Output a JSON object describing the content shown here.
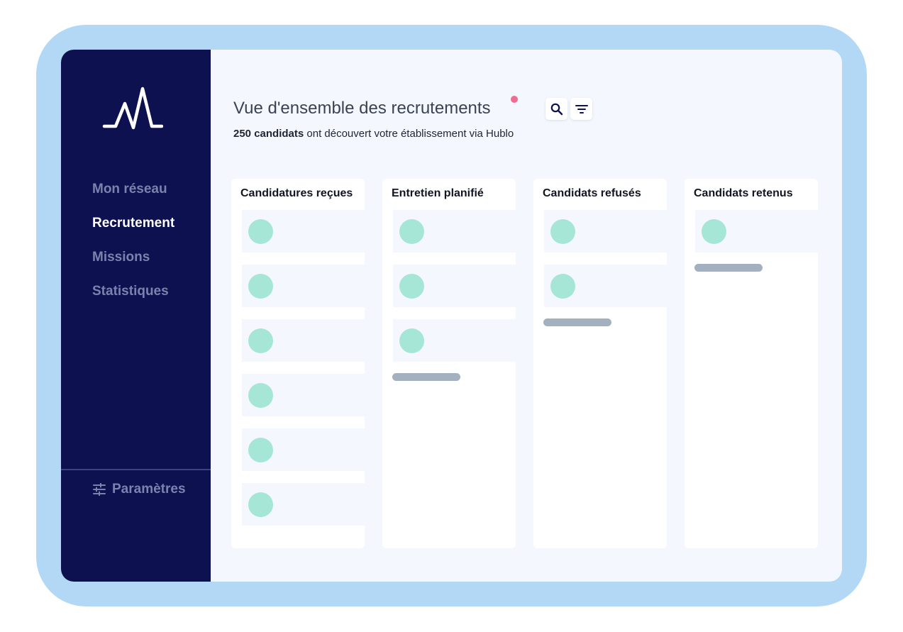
{
  "sidebar": {
    "logo_icon": "hublo-logo-icon",
    "nav_items": [
      {
        "label": "Mon réseau",
        "active": false
      },
      {
        "label": "Recrutement",
        "active": true
      },
      {
        "label": "Missions",
        "active": false
      },
      {
        "label": "Statistiques",
        "active": false
      }
    ],
    "settings_label": "Paramètres",
    "settings_icon": "sliders-icon"
  },
  "main": {
    "title": "Vue d'ensemble des recrutements",
    "subtitle_bold": "250 candidats",
    "subtitle_rest": " ont découvert votre établissement via Hublo",
    "search_icon": "search-icon",
    "filter_icon": "filter-icon"
  },
  "columns": [
    {
      "title": "Candidatures reçues",
      "cards": 6
    },
    {
      "title": "Entretien planifié",
      "cards": 3
    },
    {
      "title": "Candidats refusés",
      "cards": 2
    },
    {
      "title": "Candidats retenus",
      "cards": 1
    }
  ],
  "colors": {
    "frame": "#b2d8f5",
    "sidebar": "#0d1150",
    "avatar": "#a6e6d6",
    "notification": "#f36a8f"
  }
}
